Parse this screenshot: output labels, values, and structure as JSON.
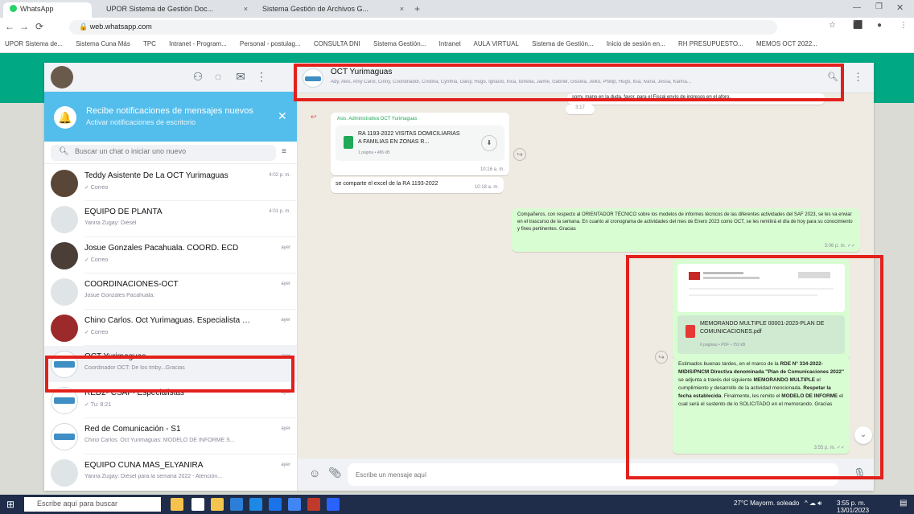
{
  "browser": {
    "tabs": [
      {
        "label": "WhatsApp",
        "active": true
      },
      {
        "label": "UPOR Sistema de Gestión Doc...",
        "active": false
      },
      {
        "label": "Sistema Gestión de Archivos G...",
        "active": false
      }
    ],
    "url": "web.whatsapp.com",
    "bookmarks": [
      "UPOR Sistema de...",
      "Sistema Cuna Más",
      "TPC",
      "Intranet - Program...",
      "Personal - postulag...",
      "CONSULTA DNI",
      "Sistema Gestión...",
      "Intranet",
      "AULA VIRTUAL",
      "Sistema de Gestión...",
      "Inicio de sesión en...",
      "RH PRESUPUESTO...",
      "MEMOS OCT 2022..."
    ]
  },
  "sidebar": {
    "notification": {
      "title": "Recibe notificaciones de mensajes nuevos",
      "subtitle": "Activar notificaciones de escritorio"
    },
    "search_placeholder": "Buscar un chat o iniciar uno nuevo",
    "chats": [
      {
        "name": "Teddy Asistente De La OCT Yurimaguas",
        "preview": "✓ Correo",
        "time": "4:02 p. m."
      },
      {
        "name": "EQUIPO DE PLANTA",
        "preview": "Yanira Zugay: Diésel",
        "time": "4:01 p. m."
      },
      {
        "name": "Josue Gonzales Pacahuala. COORD. ECD",
        "preview": "✓ Correo",
        "time": "ayer"
      },
      {
        "name": "COORDINACIONES-OCT",
        "preview": "Josue Gonzales Pacahuala:",
        "time": "ayer"
      },
      {
        "name": "Chino Carlos. Oct Yurimaguas. Especialista SAF",
        "preview": "✓ Correo",
        "time": "ayer"
      },
      {
        "name": "OCT Yurimaguas",
        "preview": "Coordinador OCT: De los tmby...Gracias",
        "time": "ayer"
      },
      {
        "name": "RED2- CSAF- Especialistas",
        "preview": "✓ Tu: 8:21",
        "time": "ayer"
      },
      {
        "name": "Red de Comunicación - S1",
        "preview": "Chino Carlos. Oct Yurimaguas: MODELO DE INFORME S...",
        "time": "ayer"
      },
      {
        "name": "EQUIPO CUNA MÁS_ELYANIRA",
        "preview": "Yanira Zugay: Diésel para la semana 2022 - Atención...",
        "time": "ayer"
      }
    ]
  },
  "chat": {
    "group_name": "OCT Yurimaguas",
    "members": "Ady, Ales, Amy Carol, Cinny, Coordinador, Cristina, Cynthia, Daisy, Hugo, Ignacio, Inca, Ismelia, Jaime, Gabriel, Gissela, Jeiko, Phillip, Hugo, Itsa, Ivana, Jessa, Karina...",
    "snippet_top": "sorry, mano en la duda, favor, para el Fiscal envío de ingresos en el aforo.",
    "snippet_top_time": "3:17",
    "doc_sender": "Asis. Administrativa OCT Yurimaguas",
    "doc_title": "RA 1193-2022 VISITAS DOMICILIARIAS A FAMILIAS EN ZONAS R...",
    "doc_meta": "1 página • 486 kB",
    "doc_time": "10:16 a. m.",
    "share_text": "se comparte el excel de la RA 1193-2022",
    "share_time": "10:18 a. m.",
    "out1_text": "Compañeros, con respecto al ORIENTADOR TÉCNICO sobre los modelos de informes técnicos de las diferentes actividades del SAF 2023, se les va enviar en el trascurso de la semana. En cuanto al cronograma de actividades del mes de Enero 2023 como OCT, se les remitirá el día de hoy para su conocimiento y fines pertinentes. Gracias",
    "out1_time": "3:06 p. m. ✓✓",
    "memo_title": "MEMORANDO MULTIPLE 00001-2023-PLAN DE COMUNICACIONES.pdf",
    "memo_meta": "6 páginas • PDF • 753 kB",
    "out2_prefix": "Estimados buenas tardes, en el marco de la ",
    "out2_bold1": "RDE N° 334-2022-MIDIS/PNCM Directiva denominada \"Plan de Comunicaciones 2022\"",
    "out2_mid": " se adjunta a través del siguiente ",
    "out2_bold2": "MEMORANDO MULTIPLE",
    "out2_mid2": " el cumplimiento y desarrollo de la actividad mencionada. ",
    "out2_bold3": "Respetar la fecha establecida",
    "out2_mid3": ". Finalmente, les remito el ",
    "out2_bold4": "MODELO DE INFORME",
    "out2_end": " el cual será el sustento de lo SOLICITADO en el memorando. Gracias",
    "out2_time": "3:55 p. m. ✓✓",
    "compose_placeholder": "Escribe un mensaje aquí"
  },
  "taskbar": {
    "search_placeholder": "Escribe aquí para buscar",
    "weather": "27°C  Mayorm. soleado",
    "clock": "3:55 p. m.",
    "date": "13/01/2023"
  },
  "colors": {
    "highlight": "#e3201b",
    "whatsapp_green": "#00a884",
    "out_bubble": "#d9fdd3",
    "notif_blue": "#53bdeb"
  }
}
